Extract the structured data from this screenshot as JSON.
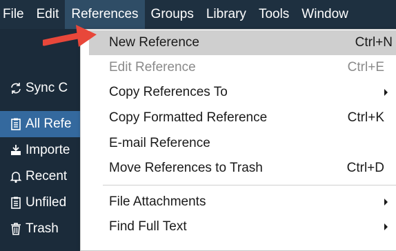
{
  "menubar": {
    "items": [
      {
        "label": "File"
      },
      {
        "label": "Edit"
      },
      {
        "label": "References"
      },
      {
        "label": "Groups"
      },
      {
        "label": "Library"
      },
      {
        "label": "Tools"
      },
      {
        "label": "Window"
      }
    ]
  },
  "sidebar": {
    "items": [
      {
        "label": "Sync C",
        "icon": "sync-icon"
      },
      {
        "label": "All Refe",
        "icon": "clipboard-icon"
      },
      {
        "label": "Importe",
        "icon": "import-icon"
      },
      {
        "label": "Recent",
        "icon": "bell-icon"
      },
      {
        "label": "Unfiled",
        "icon": "clipboard-icon"
      },
      {
        "label": "Trash",
        "icon": "trash-icon"
      }
    ]
  },
  "menu": {
    "items": [
      {
        "label": "New Reference",
        "shortcut": "Ctrl+N"
      },
      {
        "label": "Edit Reference",
        "shortcut": "Ctrl+E"
      },
      {
        "label": "Copy References To"
      },
      {
        "label": "Copy Formatted Reference",
        "shortcut": "Ctrl+K"
      },
      {
        "label": "E-mail Reference"
      },
      {
        "label": "Move References to Trash",
        "shortcut": "Ctrl+D"
      },
      {
        "label": "File Attachments"
      },
      {
        "label": "Find Full Text"
      }
    ]
  },
  "colors": {
    "menubar_bg": "#1e3040",
    "sidebar_selected": "#34699e",
    "menu_hover": "#cfcfcf",
    "arrow": "#e8473a"
  }
}
